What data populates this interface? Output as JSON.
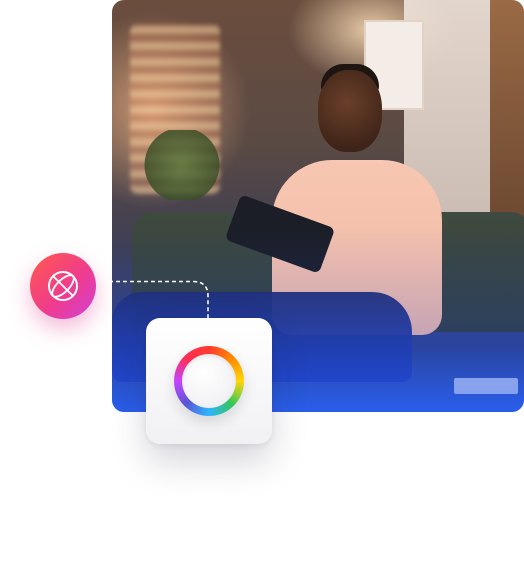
{
  "scene": {
    "photo_alt_description": "",
    "icons": {
      "badge": "globe-icon",
      "hub": "color-ring-icon"
    },
    "colors": {
      "badge_gradient_start": "#ff5a4a",
      "badge_gradient_end": "#d13fd8",
      "connector_line": "#ffffff",
      "tile_background": "#f4f4f6",
      "photo_tint": "#2a5fe0"
    }
  }
}
